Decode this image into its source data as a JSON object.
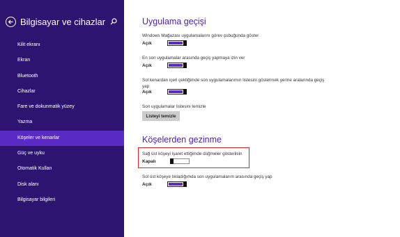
{
  "sidebar": {
    "title": "Bilgisayar ve cihazlar",
    "items": [
      {
        "label": "Kilit ekranı"
      },
      {
        "label": "Ekran"
      },
      {
        "label": "Bluetooth"
      },
      {
        "label": "Cihazlar"
      },
      {
        "label": "Fare ve dokunmatik yüzey"
      },
      {
        "label": "Yazma"
      },
      {
        "label": "Köşeler ve kenarlar",
        "active": true
      },
      {
        "label": "Güç ve uyku"
      },
      {
        "label": "Otomatik Kullan"
      },
      {
        "label": "Disk alanı"
      },
      {
        "label": "Bilgisayar bilgileri"
      }
    ]
  },
  "main": {
    "section1_title": "Uygulama geçişi",
    "setting1": {
      "text": "Windows Mağazası uygulamalarını görev çubuğunda göster",
      "state": "Açık",
      "on": true
    },
    "setting2": {
      "text": "En son uygulamalar arasında geçiş yapmaya izin ver",
      "state": "Açık",
      "on": true
    },
    "setting3": {
      "text": "Sol kenardan içeri çektiğimde son uygulamalarımın listesini göstermek yerine aralarında geçiş yap",
      "state": "Açık",
      "on": true
    },
    "clear_label": "Son uygulamalar listesini temizle",
    "clear_button": "Listeyi temizle",
    "section2_title": "Köşelerden gezinme",
    "setting4": {
      "text": "Sağ üst köşeyi işaret ettiğimde düğmeler gösterilsin",
      "state": "Kapalı",
      "on": false
    },
    "setting5": {
      "text": "Sol üst köşeye tıkladığımda son uygulamalarım arasında geçiş yap",
      "state": "Açık",
      "on": true
    }
  },
  "colors": {
    "sidebar_bg": "#2d1471",
    "sidebar_active": "#5b2bc6",
    "accent": "#4b23b0",
    "highlight": "#e02020"
  }
}
